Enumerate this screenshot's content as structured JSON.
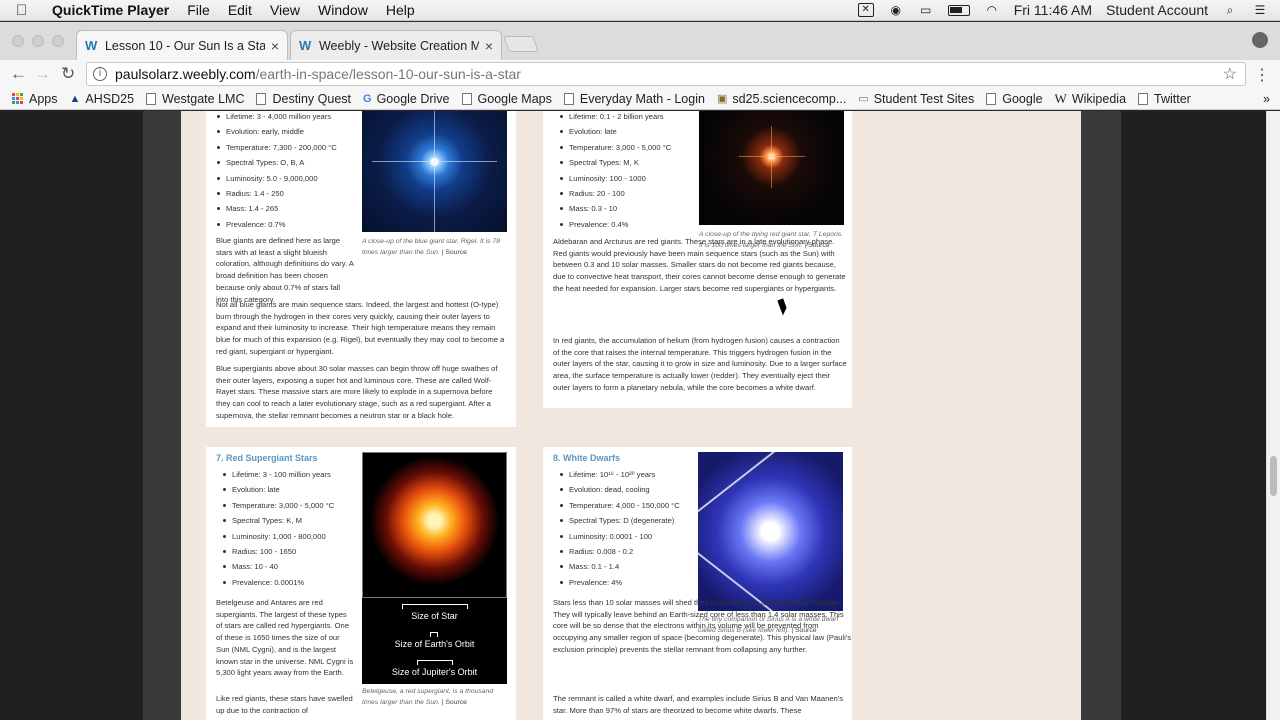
{
  "menubar": {
    "app": "QuickTime Player",
    "menus": [
      "File",
      "Edit",
      "View",
      "Window",
      "Help"
    ],
    "clock": "Fri 11:46 AM",
    "user": "Student Account"
  },
  "tabs": [
    {
      "title": "Lesson 10 - Our Sun Is a Star - ",
      "active": true
    },
    {
      "title": "Weebly - Website Creation Ma",
      "active": false
    }
  ],
  "address": {
    "host": "paulsolarz.weebly.com",
    "path": "/earth-in-space/lesson-10-our-sun-is-a-star"
  },
  "bookmarks": [
    "Apps",
    "AHSD25",
    "Westgate LMC",
    "Destiny Quest",
    "Google Drive",
    "Google Maps",
    "Everyday Math - Login",
    "sd25.sciencecomp...",
    "Student Test Sites",
    "Google",
    "Wikipedia",
    "Twitter"
  ],
  "blue_giants": {
    "facts": [
      "Lifetime: 3 - 4,000 million years",
      "Evolution: early, middle",
      "Temperature: 7,300 - 200,000 °C",
      "Spectral Types: O, B, A",
      "Luminosity: 5.0 - 9,000,000",
      "Radius: 1.4 - 250",
      "Mass: 1.4 - 265",
      "Prevalence: 0.7%"
    ],
    "caption": "A close-up of the blue giant star, Rigel. It is 78 times larger than the Sun.",
    "source": "| Source",
    "p1": "Blue giants are defined here as large stars with at least a slight blueish coloration, although definitions do vary. A broad definition has been chosen because only about 0.7% of stars fall into this category.",
    "p2": "Not all blue giants are main sequence stars. Indeed, the largest and hottest (O-type) burn through the hydrogen in their cores very quickly, causing their outer layers to expand and their luminosity to increase. Their high temperature means they remain blue for much of this expansion (e.g. Rigel), but eventually they may cool to become a red giant, supergiant or hypergiant.",
    "p3": "Blue supergiants above about 30 solar masses can begin throw off huge swathes of their outer layers, exposing a super hot and luminous core. These are called Wolf-Rayet stars. These massive stars are more likely to explode in a supernova before they can cool to reach a later evolutionary stage, such as a red supergiant. After a supernova, the stellar remnant becomes a neutron star or a black hole."
  },
  "red_giants": {
    "facts": [
      "Lifetime: 0.1 - 2 billion years",
      "Evolution: late",
      "Temperature: 3,000 - 5,000 °C",
      "Spectral Types: M, K",
      "Luminosity: 100 - 1000",
      "Radius: 20 - 100",
      "Mass: 0.3 - 10",
      "Prevalence: 0.4%"
    ],
    "caption": "A close-up of the dying red giant star, T Leporis. It is 100 times larger than the Sun.",
    "source": "| Source",
    "p1": "Aldebaran and Arcturus are red giants. These stars are in a late evolutionary phase. Red giants would previously have been main sequence stars (such as the Sun) with between 0.3 and 10 solar masses. Smaller stars do not become red giants because, due to convective heat transport, their cores cannot become dense enough to generate the heat needed for expansion. Larger stars become red supergiants or hypergiants.",
    "p2": "In red giants, the accumulation of helium (from hydrogen fusion) causes a contraction of the core that raises the internal temperature. This triggers hydrogen fusion in the outer layers of the star, causing it to grow in size and luminosity. Due to a larger surface area, the surface temperature is actually lower (redder). They eventually eject their outer layers to form a planetary nebula, while the core becomes a white dwarf."
  },
  "red_supergiants": {
    "heading": "7. Red Supergiant Stars",
    "facts": [
      "Lifetime: 3 - 100 million years",
      "Evolution: late",
      "Temperature: 3,000 - 5,000 °C",
      "Spectral Types: K, M",
      "Luminosity: 1,000 - 800,000",
      "Radius: 100 - 1650",
      "Mass: 10 - 40",
      "Prevalence: 0.0001%"
    ],
    "scale_labels": [
      "Size of Star",
      "Size of Earth's Orbit",
      "Size of Jupiter's Orbit"
    ],
    "caption": "Betelgeuse, a red supergiant, is a thousand times larger than the Sun.",
    "source": "| Source",
    "p1": "Betelgeuse and Antares are red supergiants. The largest of these types of stars are called red hypergiants. One of these is 1650 times the size of our Sun (NML Cygni), and is the largest known star in the universe. NML Cygni is 5,300 light years away from the Earth.",
    "p2": "Like red giants, these stars have swelled up due to the contraction of"
  },
  "white_dwarfs": {
    "heading": "8. White Dwarfs",
    "facts": [
      "Lifetime: 10¹⁶ - 10²⁰ years",
      "Evolution: dead, cooling",
      "Temperature: 4,000 - 150,000 °C",
      "Spectral Types: D (degenerate)",
      "Luminosity: 0.0001 - 100",
      "Radius: 0.008 - 0.2",
      "Mass: 0.1 - 1.4",
      "Prevalence: 4%"
    ],
    "caption": "The tiny companion of Sirius A is a white dwarf called Sirius B (see lower left).",
    "source": "| Source",
    "p1": "Stars less than 10 solar masses will shed their outer layers to form planetary nebulae. They will typically leave behind an Earth-sized core of less than 1.4 solar masses. This core will be so dense that the electrons within its volume will be prevented from occupying any smaller region of space (becoming degenerate). This physical law (Pauli's exclusion principle) prevents the stellar remnant from collapsing any further.",
    "p2": "The remnant is called a white dwarf, and examples include Sirius B and Van Maanen's star. More than 97% of stars are theorized to become white dwarfs. These"
  }
}
